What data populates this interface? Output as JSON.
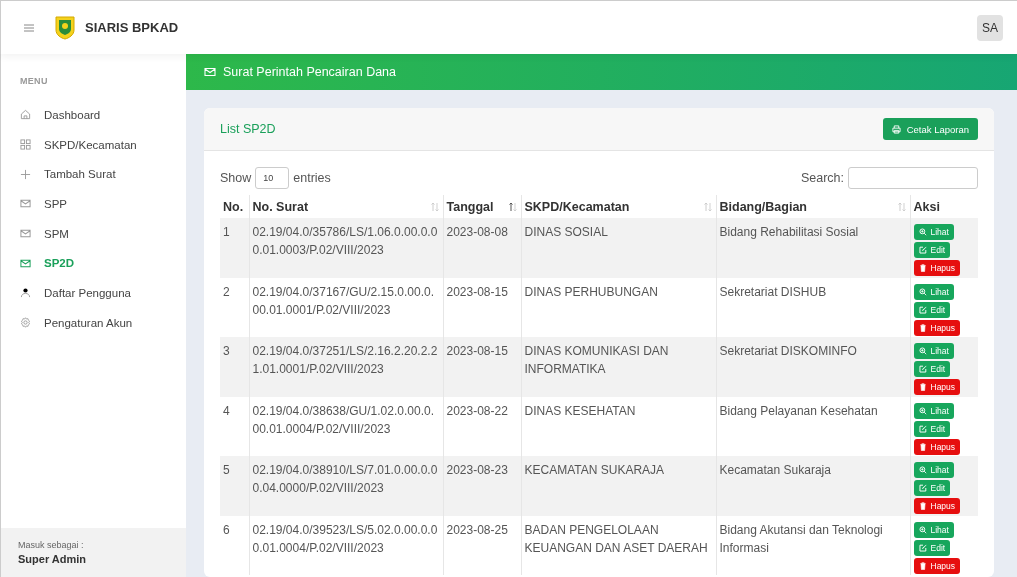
{
  "app": {
    "title": "SIARIS BPKAD",
    "avatar": "SA"
  },
  "sidebar": {
    "heading": "MENU",
    "items": [
      {
        "label": "Dashboard",
        "kind": "home",
        "selected": false
      },
      {
        "label": "SKPD/Kecamatan",
        "kind": "grid",
        "selected": false
      },
      {
        "label": "Tambah Surat",
        "kind": "plus",
        "selected": false
      },
      {
        "label": "SPP",
        "kind": "mail",
        "selected": false
      },
      {
        "label": "SPM",
        "kind": "mail",
        "selected": false
      },
      {
        "label": "SP2D",
        "kind": "mail",
        "selected": true
      },
      {
        "label": "Daftar Pengguna",
        "kind": "user",
        "selected": false
      },
      {
        "label": "Pengaturan Akun",
        "kind": "gear",
        "selected": false
      }
    ],
    "footer": {
      "caption": "Masuk sebagai :",
      "role": "Super Admin"
    }
  },
  "banner": {
    "title": "Surat Perintah Pencairan Dana"
  },
  "card": {
    "title": "List SP2D",
    "print_button": "Cetak Laporan"
  },
  "controls": {
    "show_label": "Show",
    "page_size": "10",
    "entries_label": "entries",
    "search_label": "Search:"
  },
  "table": {
    "columns": [
      {
        "label": "No.",
        "sortable": false,
        "sorted": false
      },
      {
        "label": "No. Surat",
        "sortable": true,
        "sorted": false
      },
      {
        "label": "Tanggal",
        "sortable": true,
        "sorted": true
      },
      {
        "label": "SKPD/Kecamatan",
        "sortable": true,
        "sorted": false
      },
      {
        "label": "Bidang/Bagian",
        "sortable": true,
        "sorted": false
      },
      {
        "label": "Aksi",
        "sortable": false,
        "sorted": false
      }
    ],
    "rows": [
      {
        "no": "1",
        "surat": "02.19/04.0/35786/LS/1.06.0.00.0.00.01.0003/P.02/VIII/2023",
        "tanggal": "2023-08-08",
        "skpd": "DINAS SOSIAL",
        "bidang": "Bidang Rehabilitasi Sosial",
        "actions": [
          {
            "kind": "view",
            "label": "Lihat"
          },
          {
            "kind": "edit",
            "label": "Edit"
          },
          {
            "kind": "delete",
            "label": "Hapus"
          }
        ]
      },
      {
        "no": "2",
        "surat": "02.19/04.0/37167/GU/2.15.0.00.0.00.01.0001/P.02/VIII/2023",
        "tanggal": "2023-08-15",
        "skpd": "DINAS PERHUBUNGAN",
        "bidang": "Sekretariat DISHUB",
        "actions": [
          {
            "kind": "view",
            "label": "Lihat"
          },
          {
            "kind": "edit",
            "label": "Edit"
          },
          {
            "kind": "delete",
            "label": "Hapus"
          }
        ]
      },
      {
        "no": "3",
        "surat": "02.19/04.0/37251/LS/2.16.2.20.2.21.01.0001/P.02/VIII/2023",
        "tanggal": "2023-08-15",
        "skpd": "DINAS KOMUNIKASI DAN INFORMATIKA",
        "bidang": "Sekretariat DISKOMINFO",
        "actions": [
          {
            "kind": "view",
            "label": "Lihat"
          },
          {
            "kind": "edit",
            "label": "Edit"
          },
          {
            "kind": "delete",
            "label": "Hapus"
          }
        ]
      },
      {
        "no": "4",
        "surat": "02.19/04.0/38638/GU/1.02.0.00.0.00.01.0004/P.02/VIII/2023",
        "tanggal": "2023-08-22",
        "skpd": "DINAS KESEHATAN",
        "bidang": "Bidang Pelayanan Kesehatan",
        "actions": [
          {
            "kind": "view",
            "label": "Lihat"
          },
          {
            "kind": "edit",
            "label": "Edit"
          },
          {
            "kind": "delete",
            "label": "Hapus"
          }
        ]
      },
      {
        "no": "5",
        "surat": "02.19/04.0/38910/LS/7.01.0.00.0.00.04.0000/P.02/VIII/2023",
        "tanggal": "2023-08-23",
        "skpd": "KECAMATAN SUKARAJA",
        "bidang": "Kecamatan Sukaraja",
        "actions": [
          {
            "kind": "view",
            "label": "Lihat"
          },
          {
            "kind": "edit",
            "label": "Edit"
          },
          {
            "kind": "delete",
            "label": "Hapus"
          }
        ]
      },
      {
        "no": "6",
        "surat": "02.19/04.0/39523/LS/5.02.0.00.0.00.01.0004/P.02/VIII/2023",
        "tanggal": "2023-08-25",
        "skpd": "BADAN PENGELOLAAN KEUANGAN DAN ASET DAERAH",
        "bidang": "Bidang Akutansi dan Teknologi Informasi",
        "actions": [
          {
            "kind": "view",
            "label": "Lihat"
          },
          {
            "kind": "edit",
            "label": "Edit"
          },
          {
            "kind": "delete",
            "label": "Hapus"
          }
        ]
      }
    ]
  }
}
